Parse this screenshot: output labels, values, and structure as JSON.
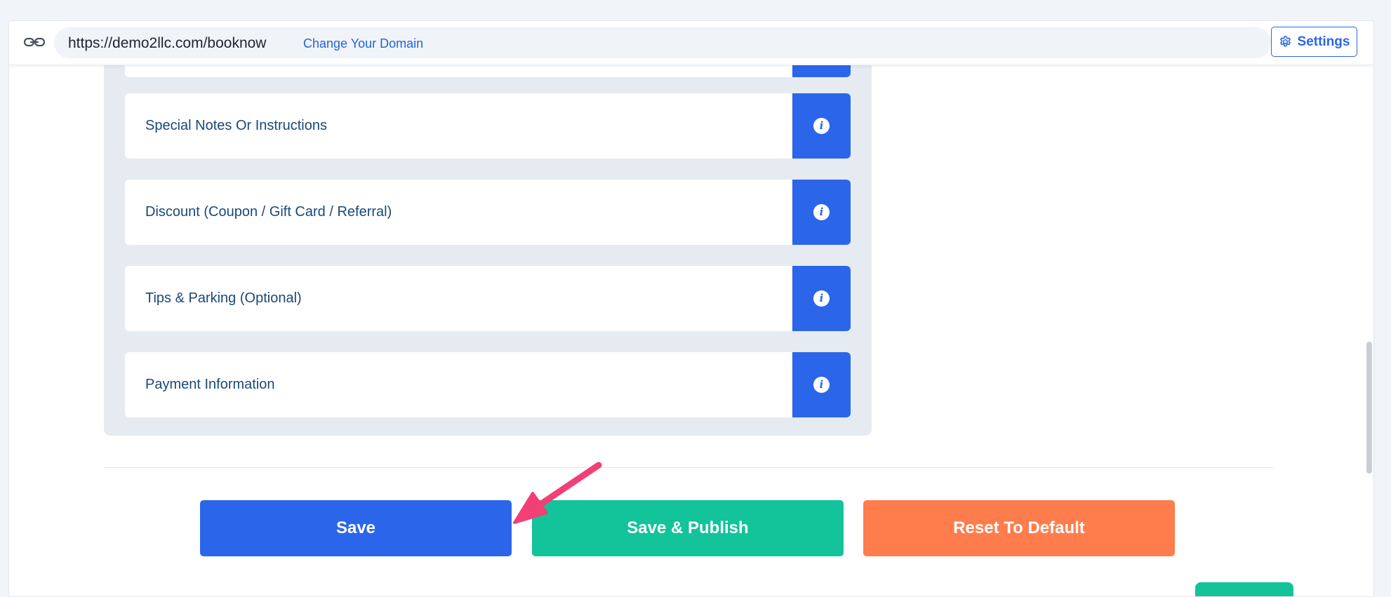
{
  "header": {
    "url": "https://demo2llc.com/booknow",
    "change_domain_label": "Change Your Domain",
    "settings_label": "Settings"
  },
  "sections": [
    {
      "label": "Special Notes Or Instructions"
    },
    {
      "label": "Discount (Coupon / Gift Card / Referral)"
    },
    {
      "label": "Tips & Parking (Optional)"
    },
    {
      "label": "Payment Information"
    }
  ],
  "info_glyph": "i",
  "actions": {
    "save_label": "Save",
    "save_publish_label": "Save & Publish",
    "reset_label": "Reset To Default"
  },
  "colors": {
    "primary": "#2b66ea",
    "publish": "#13c39a",
    "reset": "#ff7d4d",
    "annotation_arrow": "#f23f76"
  },
  "icons": {
    "link": "link-icon",
    "settings": "gear-icon",
    "info": "info-icon",
    "annotation": "arrow-annotation"
  }
}
